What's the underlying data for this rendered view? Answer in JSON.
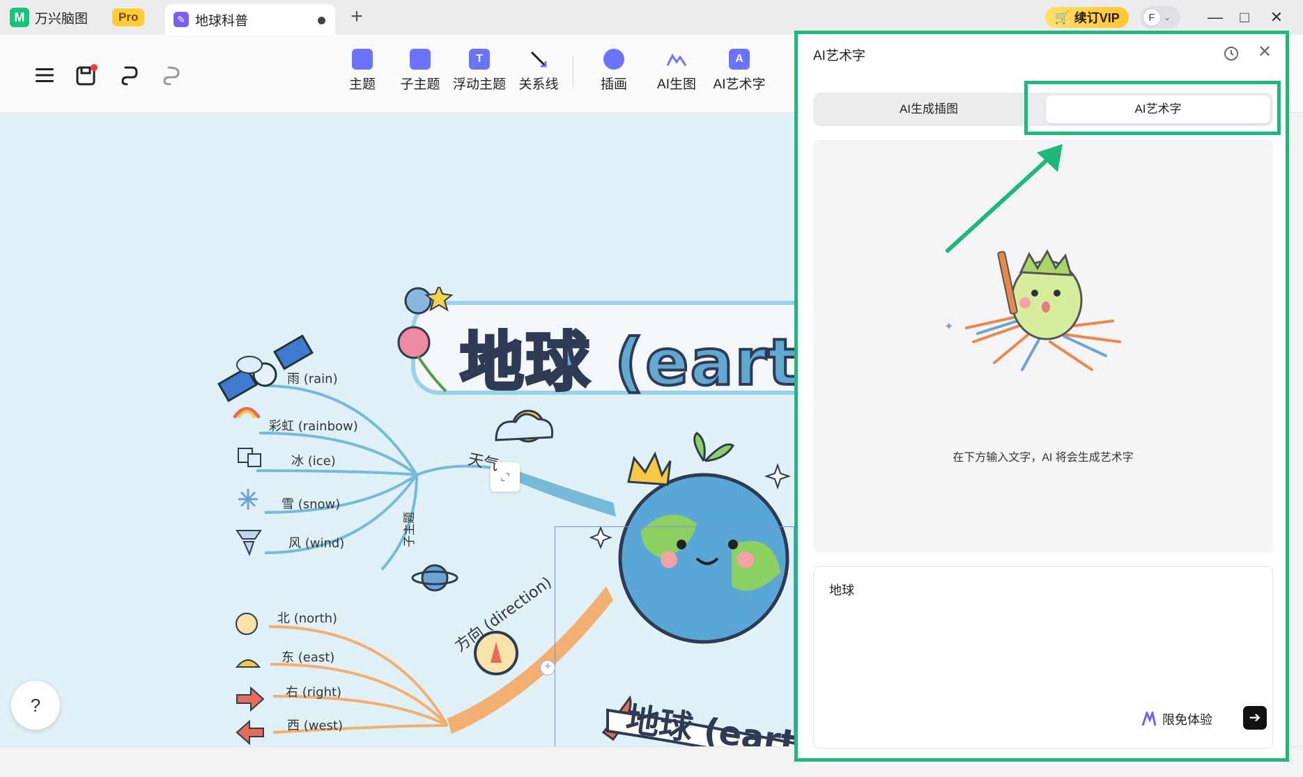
{
  "titlebar": {
    "app_name": "万兴脑图",
    "pro_badge": "Pro",
    "doc_tab": "地球科普",
    "new_tab": "+",
    "vip_label": "续订VIP",
    "avatar_letter": "F",
    "window_buttons": [
      "—",
      "□",
      "✕"
    ]
  },
  "toolbar": {
    "tools": [
      "主题",
      "子主题",
      "浮动主题",
      "关系线",
      "插画",
      "AI生图",
      "AI艺术字"
    ]
  },
  "canvas": {
    "banner_title": "地球 (eart",
    "branches": {
      "weather": "天气",
      "direction": "方向 (direction)",
      "subtopic": "子主题"
    },
    "weather_leaves": [
      "雨 (rain)",
      "彩虹 (rainbow)",
      "冰 (ice)",
      "雪 (snow)",
      "风 (wind)"
    ],
    "direction_leaves": [
      "北 (north)",
      "东 (east)",
      "右 (right)",
      "西 (west)"
    ],
    "center_ribbon": "地球 (earth)",
    "collapse_icon": "⌞⌝",
    "help": "?"
  },
  "panel": {
    "title": "AI艺术字",
    "tabs": [
      "AI生成插图",
      "AI艺术字"
    ],
    "active_tab": "AI艺术字",
    "hint": "在下方输入文字，AI 将会生成艺术字",
    "input_value": "地球",
    "trial_label": "限免体验",
    "send": "➔"
  },
  "colors": {
    "accent": "#1db87a",
    "canvas_bg": "#dff0f6",
    "weather_branch": "#76b9d8",
    "direction_branch": "#f3ae72"
  }
}
